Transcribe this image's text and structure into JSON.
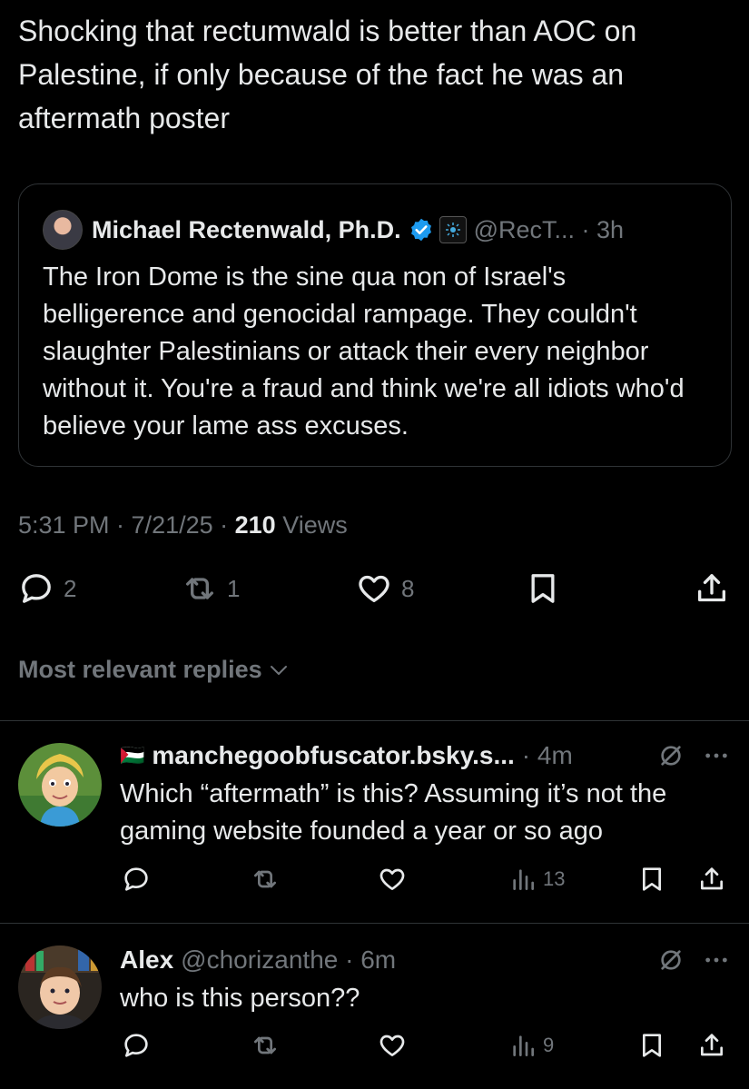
{
  "tweet": {
    "text": "Shocking that rectumwald is better than AOC on Palestine, if only because of the fact he was an aftermath poster"
  },
  "quote": {
    "author_name": "Michael Rectenwald, Ph.D.",
    "handle_time": "@RecT... · 3h",
    "body": "The Iron Dome is the sine qua non of Israel's belligerence and genocidal rampage. They couldn't slaughter Palestinians or attack their every neighbor without it. You're a fraud and think we're all idiots who'd believe your lame ass excuses."
  },
  "meta": {
    "time_date": "5:31 PM · 7/21/25 · ",
    "views_count": "210",
    "views_label": " Views"
  },
  "actions": {
    "replies": "2",
    "reposts": "1",
    "likes": "8"
  },
  "sort": {
    "label": "Most relevant replies"
  },
  "replies": [
    {
      "flag": "🇵🇸",
      "name": "manchegoobfuscator.bsky.s...",
      "handle_time": "· 4m",
      "text": "Which “aftermath” is this? Assuming it’s not the gaming website founded a year or so ago",
      "views": "13"
    },
    {
      "name": "Alex",
      "handle_time": "@chorizanthe · 6m",
      "text": "who is this person??",
      "views": "9"
    }
  ],
  "colors": {
    "background": "#000000",
    "text": "#e7e9ea",
    "muted": "#71767b",
    "verified": "#1d9bf0",
    "border": "#2f3336"
  }
}
